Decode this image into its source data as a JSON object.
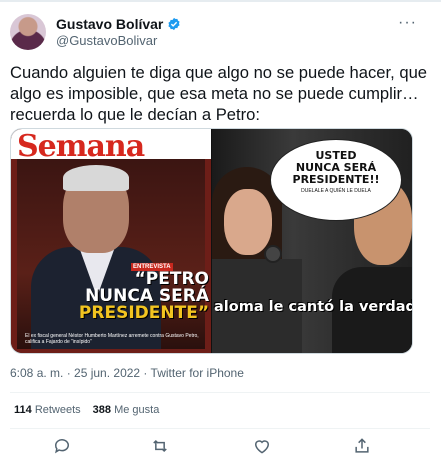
{
  "author": {
    "name": "Gustavo Bolívar",
    "handle": "@GustavoBolivar"
  },
  "menu": {
    "more_label": "···"
  },
  "tweet": {
    "text": "Cuando alguien te diga que algo no se puede hacer, que algo es imposible, que esa meta no se puede cumplir… recuerda lo que le decían a Petro:"
  },
  "media": {
    "cover": {
      "masthead": "Semana",
      "kicker": "ENTREVISTA",
      "quote_line1": "“PETRO",
      "quote_line2": "NUNCA SERÁ",
      "quote_line3": "PRESIDENTE”",
      "caption": "El ex fiscal general Néstor Humberto Martínez arremete contra Gustavo Petro, califica a Fajardo de “insípido”"
    },
    "bubble": {
      "main_line1": "USTED",
      "main_line2": "NUNCA SERÁ",
      "main_line3": "PRESIDENTE!!",
      "sub": "DUELALE A QUIÉN LE DUELA"
    },
    "overlay": "aloma le cantó la verdad a"
  },
  "meta": {
    "timestamp": "6:08 a. m. · 25 jun. 2022 · Twitter for iPhone"
  },
  "stats": {
    "retweets_count": "114",
    "retweets_label": "Retweets",
    "likes_count": "388",
    "likes_label": "Me gusta"
  },
  "colors": {
    "verified": "#1d9bf0",
    "secondary_text": "#536471",
    "masthead_red": "#d6281e",
    "quote_yellow": "#f2c420"
  },
  "icons": [
    "verified-badge-icon",
    "more-icon",
    "reply-icon",
    "retweet-icon",
    "like-icon",
    "share-icon"
  ]
}
